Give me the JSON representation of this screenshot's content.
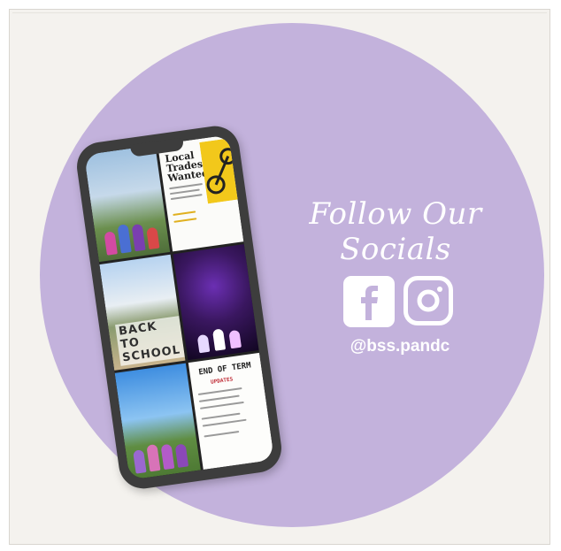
{
  "tiles": {
    "trades_title": "Local Trades Wanted",
    "back_to_school": "BACK TO SCHOOL",
    "end_of_term": "END OF TERM",
    "updates": "UPDATES"
  },
  "headline": "Follow Our Socials",
  "handle": "@bss.pandc",
  "icons": [
    "facebook-icon",
    "instagram-icon"
  ],
  "colors": {
    "circle": "#c3b2dc",
    "background": "#f4f2ee",
    "phone": "#3d3d3d",
    "text": "#ffffff"
  }
}
